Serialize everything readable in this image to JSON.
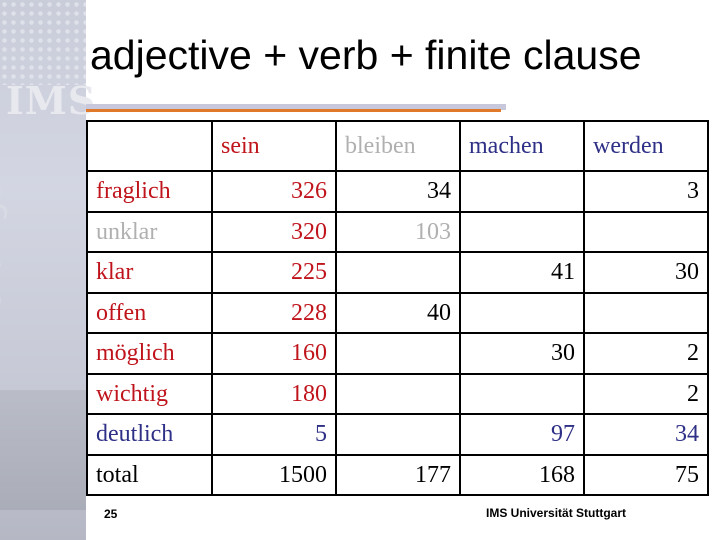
{
  "slide": {
    "title": "adjective + verb + finite clause",
    "page_number": "25",
    "footer": "IMS Universität Stuttgart",
    "sidebar_logo": "IMS",
    "sidebar_text": "Stuttgart"
  },
  "colors": {
    "red": "#c0141c",
    "gray": "#b0b0b0",
    "blue": "#2e2f86",
    "black": "#000000",
    "accent": "#e07a2a"
  },
  "table": {
    "headers": [
      {
        "label": "",
        "color": "black"
      },
      {
        "label": "sein",
        "color": "red"
      },
      {
        "label": "bleiben",
        "color": "gray"
      },
      {
        "label": "machen",
        "color": "blue"
      },
      {
        "label": "werden",
        "color": "blue"
      }
    ],
    "rows": [
      {
        "label": "fraglich",
        "color": "red",
        "cells": [
          {
            "v": "326",
            "c": "red"
          },
          {
            "v": "34",
            "c": "black"
          },
          {
            "v": "",
            "c": "black"
          },
          {
            "v": "3",
            "c": "black"
          }
        ]
      },
      {
        "label": "unklar",
        "color": "gray",
        "cells": [
          {
            "v": "320",
            "c": "red"
          },
          {
            "v": "103",
            "c": "gray"
          },
          {
            "v": "",
            "c": "black"
          },
          {
            "v": "",
            "c": "black"
          }
        ]
      },
      {
        "label": "klar",
        "color": "red",
        "cells": [
          {
            "v": "225",
            "c": "red"
          },
          {
            "v": "",
            "c": "black"
          },
          {
            "v": "41",
            "c": "black"
          },
          {
            "v": "30",
            "c": "black"
          }
        ]
      },
      {
        "label": "offen",
        "color": "red",
        "cells": [
          {
            "v": "228",
            "c": "red"
          },
          {
            "v": "40",
            "c": "black"
          },
          {
            "v": "",
            "c": "black"
          },
          {
            "v": "",
            "c": "black"
          }
        ]
      },
      {
        "label": "möglich",
        "color": "red",
        "cells": [
          {
            "v": "160",
            "c": "red"
          },
          {
            "v": "",
            "c": "black"
          },
          {
            "v": "30",
            "c": "black"
          },
          {
            "v": "2",
            "c": "black"
          }
        ]
      },
      {
        "label": "wichtig",
        "color": "red",
        "cells": [
          {
            "v": "180",
            "c": "red"
          },
          {
            "v": "",
            "c": "black"
          },
          {
            "v": "",
            "c": "black"
          },
          {
            "v": "2",
            "c": "black"
          }
        ]
      },
      {
        "label": "deutlich",
        "color": "blue",
        "cells": [
          {
            "v": "5",
            "c": "blue"
          },
          {
            "v": "",
            "c": "black"
          },
          {
            "v": "97",
            "c": "blue"
          },
          {
            "v": "34",
            "c": "blue"
          }
        ]
      },
      {
        "label": "total",
        "color": "black",
        "cells": [
          {
            "v": "1500",
            "c": "black"
          },
          {
            "v": "177",
            "c": "black"
          },
          {
            "v": "168",
            "c": "black"
          },
          {
            "v": "75",
            "c": "black"
          }
        ]
      }
    ]
  }
}
